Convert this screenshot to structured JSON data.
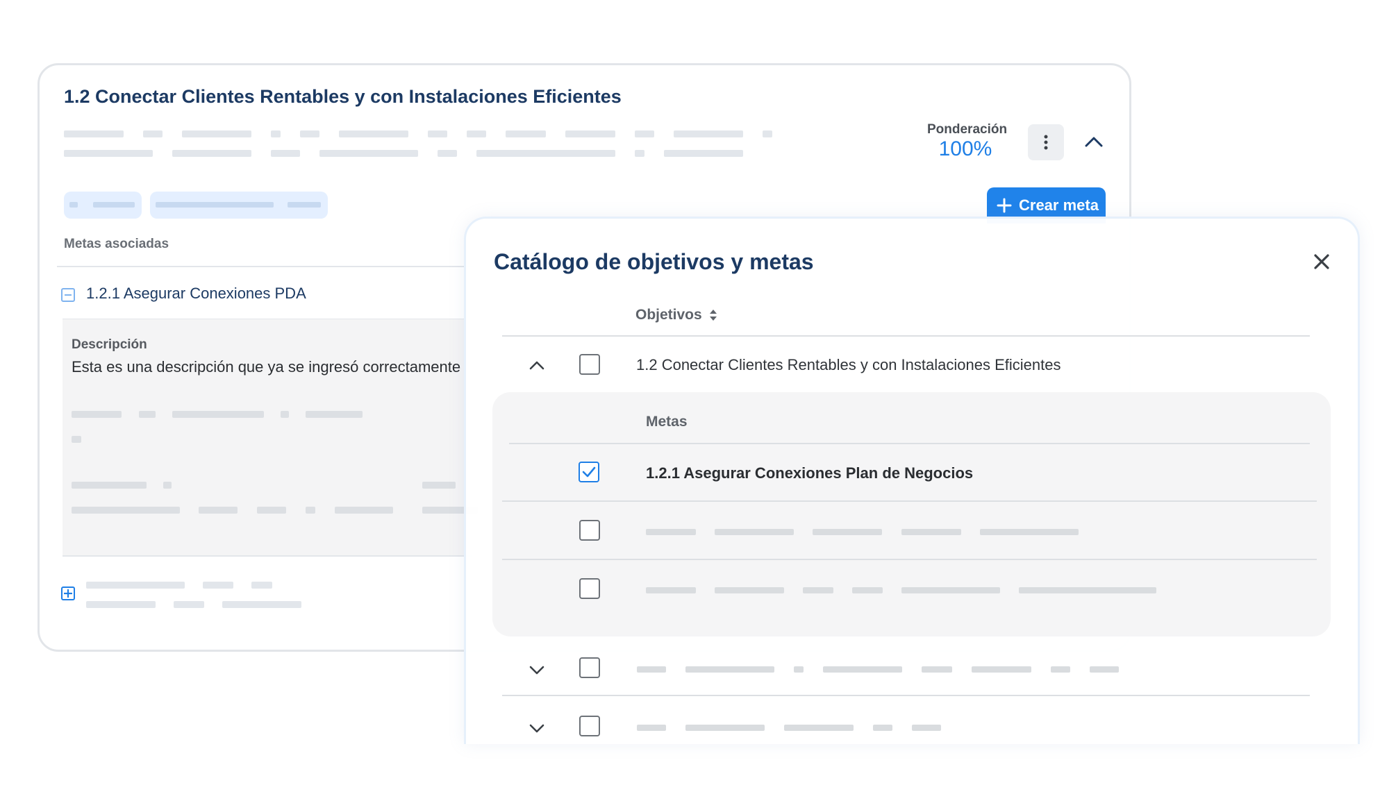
{
  "card": {
    "title": "1.2 Conectar Clientes Rentables y con Instalaciones Eficientes",
    "ponderacion_label": "Ponderación",
    "ponderacion_value": "100%",
    "create_button": "Crear meta",
    "metas_label": "Metas asociadas",
    "meta_item": "1.2.1 Asegurar Conexiones PDA",
    "description_label": "Descripción",
    "description_text": "Esta es una descripción que ya se ingresó correctamente"
  },
  "modal": {
    "title": "Catálogo de objetivos y metas",
    "column_header": "Objetivos",
    "objective_row": "1.2 Conectar Clientes Rentables y con Instalaciones Eficientes",
    "sub_header": "Metas",
    "meta_row": "1.2.1 Asegurar Conexiones Plan de Negocios"
  },
  "icons": {
    "more": "vertical-dots-icon",
    "collapse": "chevron-up-icon",
    "plus": "plus-icon",
    "close": "close-icon",
    "sort": "sort-icon",
    "checkbox_checked": "checkmark-icon"
  },
  "colors": {
    "primary": "#2083ea",
    "title": "#1c3a63",
    "accent_value": "#1f7fe6"
  }
}
